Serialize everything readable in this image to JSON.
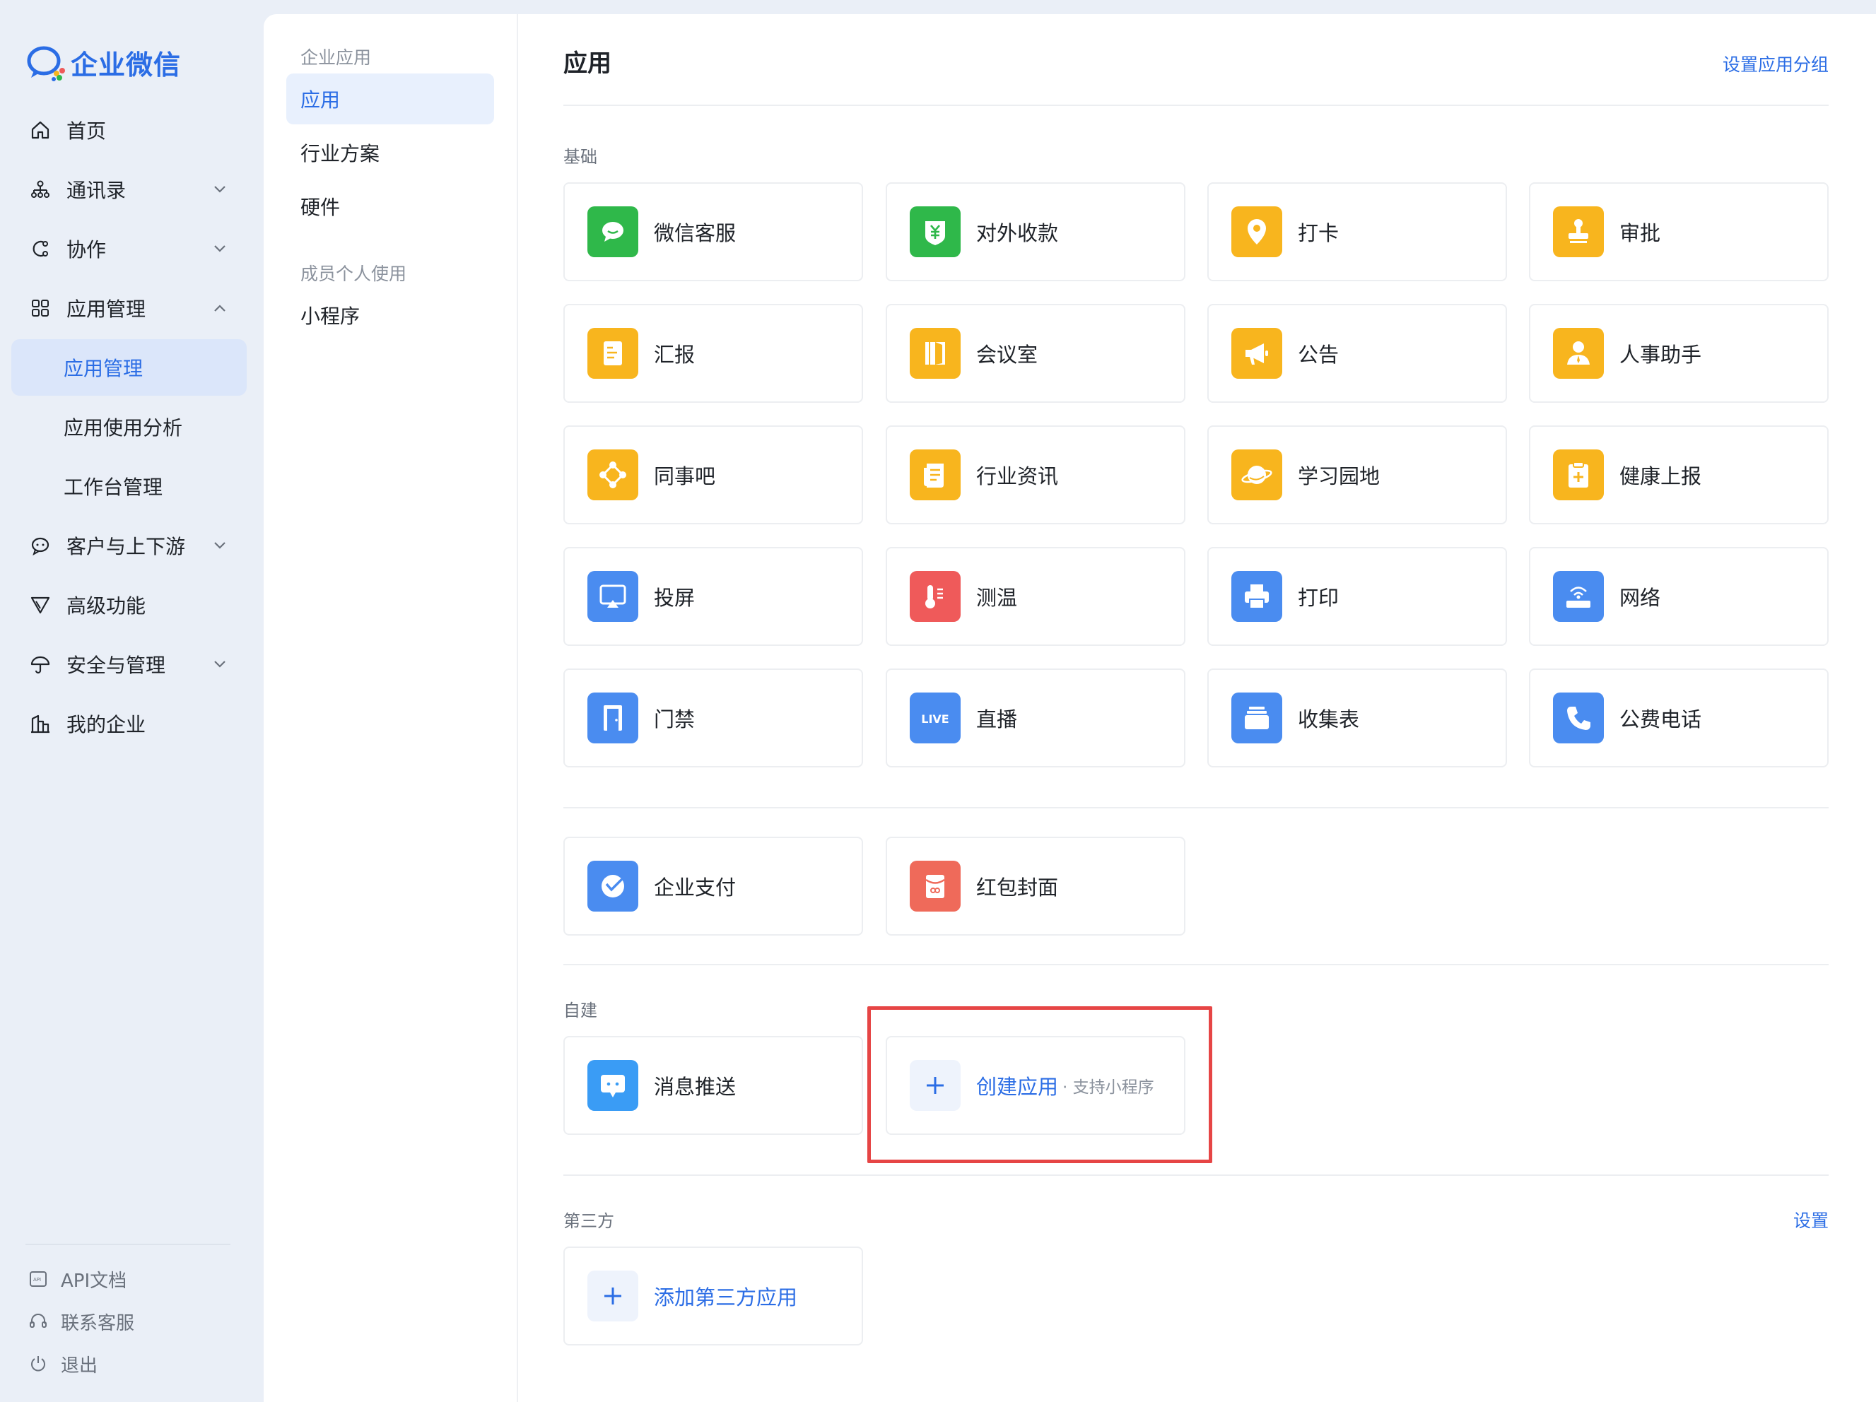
{
  "brand": {
    "name": "企业微信",
    "accent": "#2b6de5"
  },
  "nav": {
    "home": "首页",
    "contacts": "通讯录",
    "collab": "协作",
    "apps": "应用管理",
    "apps_sub": [
      "应用管理",
      "应用使用分析",
      "工作台管理"
    ],
    "customers": "客户与上下游",
    "advanced": "高级功能",
    "security": "安全与管理",
    "company": "我的企业"
  },
  "bottom_links": {
    "api": "API文档",
    "support": "联系客服",
    "logout": "退出"
  },
  "submenu": {
    "group_enterprise": "企业应用",
    "items": [
      "应用",
      "行业方案",
      "硬件"
    ],
    "group_personal": "成员个人使用",
    "personal_items": [
      "小程序"
    ]
  },
  "main": {
    "title": "应用",
    "set_groups": "设置应用分组",
    "section_basic": "基础",
    "basic_apps": [
      {
        "name": "微信客服",
        "icon": "chat-bubble-icon",
        "color": "#2fb84a"
      },
      {
        "name": "对外收款",
        "icon": "yuan-shield-icon",
        "color": "#2fb84a"
      },
      {
        "name": "打卡",
        "icon": "location-pin-icon",
        "color": "#f8b51e"
      },
      {
        "name": "审批",
        "icon": "stamp-icon",
        "color": "#f8b51e"
      },
      {
        "name": "汇报",
        "icon": "report-icon",
        "color": "#f8b51e"
      },
      {
        "name": "会议室",
        "icon": "door-icon",
        "color": "#f8b51e"
      },
      {
        "name": "公告",
        "icon": "megaphone-icon",
        "color": "#f8b51e"
      },
      {
        "name": "人事助手",
        "icon": "person-icon",
        "color": "#f8b51e"
      },
      {
        "name": "同事吧",
        "icon": "network-icon",
        "color": "#f8b51e"
      },
      {
        "name": "行业资讯",
        "icon": "news-icon",
        "color": "#f8b51e"
      },
      {
        "name": "学习园地",
        "icon": "planet-icon",
        "color": "#f8b51e"
      },
      {
        "name": "健康上报",
        "icon": "health-clipboard-icon",
        "color": "#f8b51e"
      },
      {
        "name": "投屏",
        "icon": "screen-cast-icon",
        "color": "#4a8cf0"
      },
      {
        "name": "测温",
        "icon": "thermometer-icon",
        "color": "#ef5a5a"
      },
      {
        "name": "打印",
        "icon": "printer-icon",
        "color": "#4a8cf0"
      },
      {
        "name": "网络",
        "icon": "router-icon",
        "color": "#4a8cf0"
      },
      {
        "name": "门禁",
        "icon": "door-access-icon",
        "color": "#4a8cf0"
      },
      {
        "name": "直播",
        "icon": "live-icon",
        "color": "#4a8cf0",
        "badge": "LIVE"
      },
      {
        "name": "收集表",
        "icon": "inbox-icon",
        "color": "#4a8cf0"
      },
      {
        "name": "公费电话",
        "icon": "phone-icon",
        "color": "#4a8cf0"
      }
    ],
    "pay_apps": [
      {
        "name": "企业支付",
        "icon": "pay-icon",
        "color": "#4a8cf0"
      },
      {
        "name": "红包封面",
        "icon": "red-packet-icon",
        "color": "#ef6a5a"
      }
    ],
    "section_custom": "自建",
    "custom_apps": [
      {
        "name": "消息推送",
        "icon": "message-push-icon",
        "color": "#3a9cf5"
      }
    ],
    "create_app": {
      "label": "创建应用",
      "hint": "· 支持小程序"
    },
    "section_third": "第三方",
    "third_settings": "设置",
    "add_third": "添加第三方应用"
  }
}
